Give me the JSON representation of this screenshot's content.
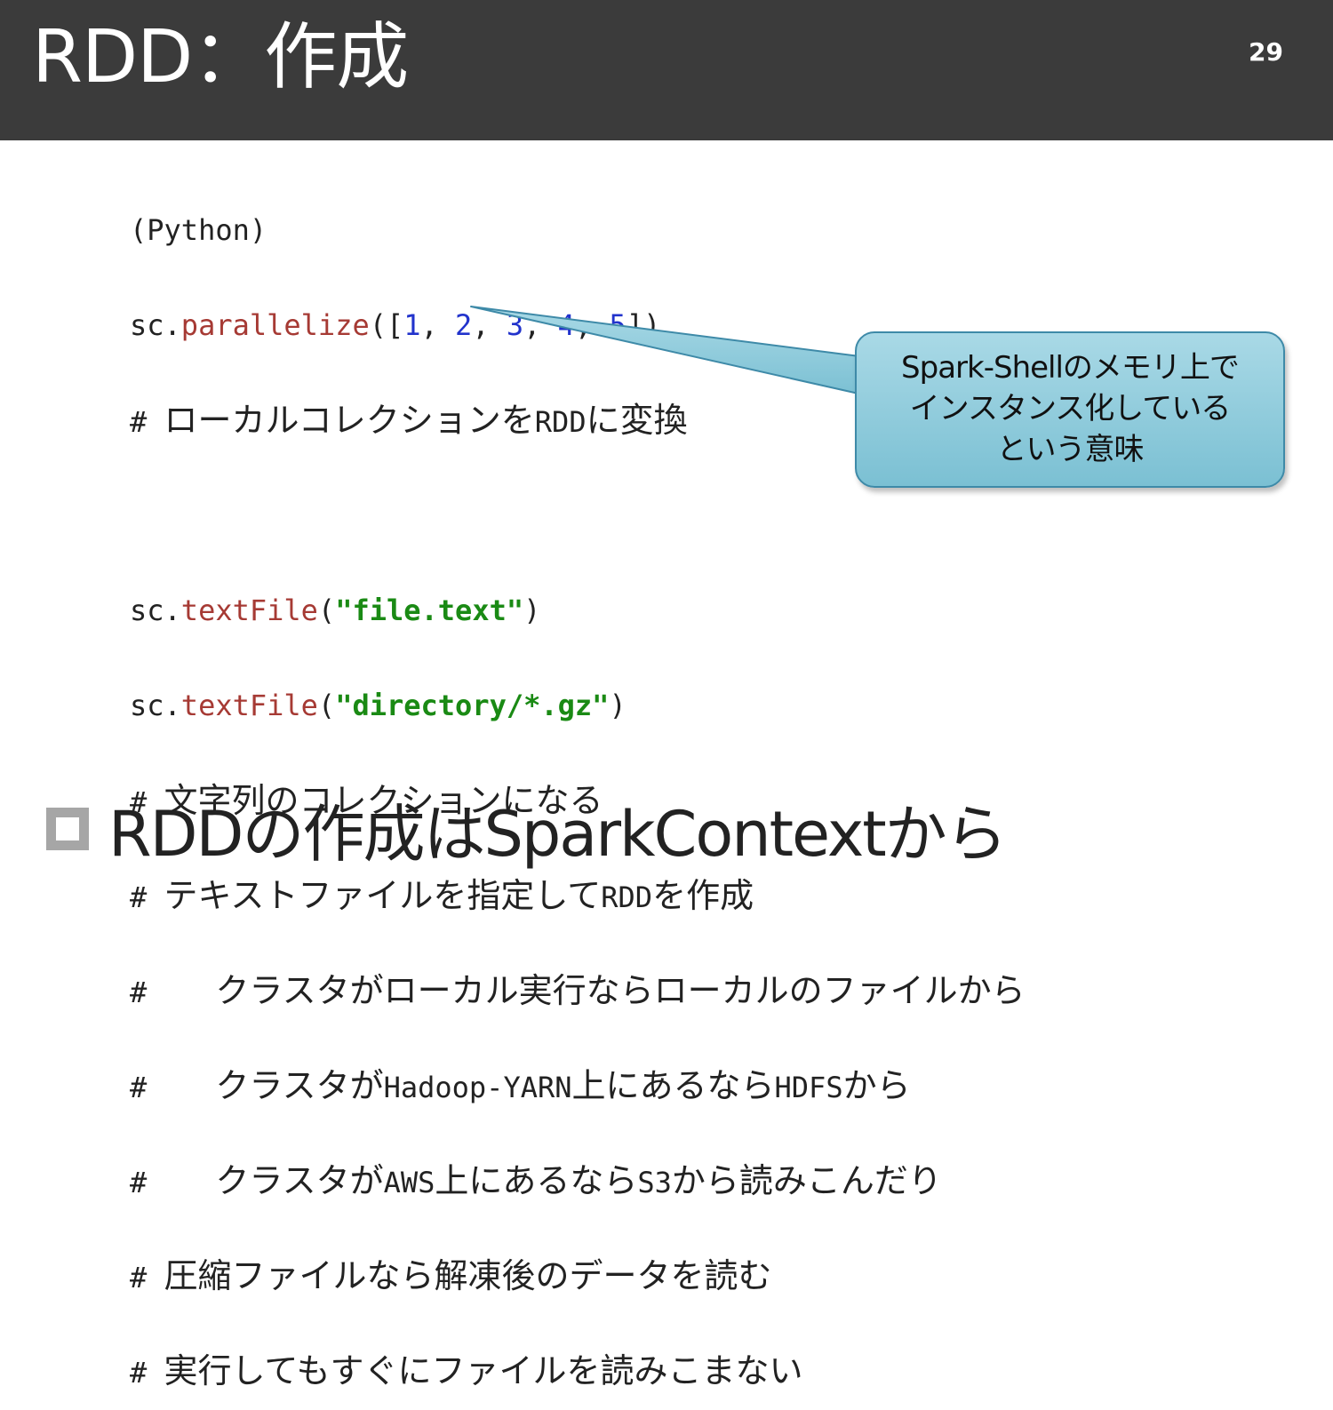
{
  "slide": {
    "title": "RDD：作成",
    "page_number": "29"
  },
  "code": {
    "lang_label": "(Python)",
    "parallelize": {
      "obj": "sc.",
      "fn": "parallelize",
      "open": "([",
      "nums": [
        "1",
        "2",
        "3",
        "4",
        "5"
      ],
      "sep": ", ",
      "close": "])"
    },
    "comment1": {
      "hash": "# ",
      "a": "ローカルコレクションを",
      "b": "RDD",
      "c": "に変換"
    },
    "textfile1": {
      "obj": "sc.",
      "fn": "textFile",
      "open": "(",
      "arg": "\"file.text\"",
      "close": ")"
    },
    "textfile2": {
      "obj": "sc.",
      "fn": "textFile",
      "open": "(",
      "arg": "\"directory/*.gz\"",
      "close": ")"
    },
    "comments": {
      "c2": {
        "hash": "# ",
        "a": "文字列のコレクションになる"
      },
      "c3": {
        "hash": "# ",
        "a": "テキストファイルを指定して",
        "b": "RDD",
        "c": "を作成"
      },
      "c4": {
        "hash": "#    ",
        "a": "クラスタがローカル実行ならローカルのファイルから"
      },
      "c5": {
        "hash": "#    ",
        "a": "クラスタが",
        "b": "Hadoop-YARN",
        "c": "上にあるなら",
        "d": "HDFS",
        "e": "から"
      },
      "c6": {
        "hash": "#    ",
        "a": "クラスタが",
        "b": "AWS",
        "c": "上にあるなら",
        "d": "S3",
        "e": "から読みこんだり"
      },
      "c7": {
        "hash": "# ",
        "a": "圧縮ファイルなら解凍後のデータを読む"
      },
      "c8": {
        "hash": "# ",
        "a": "実行してもすぐにファイルを読みこまない"
      }
    }
  },
  "bullet": {
    "text": "RDDの作成はSparkContextから"
  },
  "callout": {
    "text": "Spark-Shellのメモリ上で\nインスタンス化している\nという意味"
  },
  "colors": {
    "header_bg": "#3b3b3b",
    "function": "#a63a34",
    "number": "#2233cc",
    "string": "#1a8a14",
    "callout_fill": "#8ccbdc",
    "bullet_square": "#a6a6a6"
  }
}
